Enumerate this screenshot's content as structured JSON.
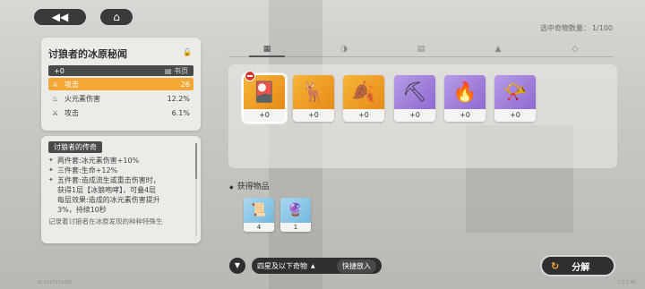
{
  "nav": {
    "back_icon": "back-arrow-icon",
    "home_icon": "home-icon"
  },
  "counter": {
    "label": "选中奇物数量：",
    "value": "1/100"
  },
  "set": {
    "title": "讨狼者的冰原秘闻",
    "level": "+0",
    "book_label": "书页",
    "stats": [
      {
        "icon": "sword-icon",
        "name": "攻击",
        "value": "26",
        "main": true
      },
      {
        "icon": "fire-icon",
        "name": "火元素伤害",
        "value": "12.2%",
        "main": false
      },
      {
        "icon": "sword-icon",
        "name": "攻击",
        "value": "6.1%",
        "main": false
      }
    ]
  },
  "legend": {
    "header": "讨狼者的传奇",
    "lines": [
      {
        "bullet": "✦",
        "text": "两件套:冰元素伤害+10%"
      },
      {
        "bullet": "✦",
        "text": "三件套:生命+12%"
      },
      {
        "bullet": "✦",
        "text": "五件套:造成流生或重击伤害时，"
      }
    ],
    "cont_lines": [
      "获得1层【冰狼咆哮】，可叠4层",
      "每层效果:造成的冰元素伤害提升",
      "3%，持续10秒"
    ],
    "lore": "记录着讨狼者在冰原发现的种种特殊生"
  },
  "tabs": [
    {
      "icon": "grid-icon",
      "glyph": "▦"
    },
    {
      "icon": "leaf-icon",
      "glyph": "◑"
    },
    {
      "icon": "book-icon",
      "glyph": "▤"
    },
    {
      "icon": "flame-icon",
      "glyph": "▲"
    },
    {
      "icon": "wings-icon",
      "glyph": "◇"
    }
  ],
  "inventory": [
    {
      "name": "item-scroll-cloth",
      "glyph": "🎴",
      "rarity": "orange",
      "level": "+0"
    },
    {
      "name": "item-antler",
      "glyph": "🦌",
      "rarity": "orange",
      "level": "+0"
    },
    {
      "name": "item-leaf",
      "glyph": "🍂",
      "rarity": "orange",
      "level": "+0"
    },
    {
      "name": "item-pickaxe",
      "glyph": "⛏",
      "rarity": "purple",
      "level": "+0"
    },
    {
      "name": "item-torch",
      "glyph": "🔥",
      "rarity": "purple",
      "level": "+0"
    },
    {
      "name": "item-horn",
      "glyph": "📯",
      "rarity": "purple",
      "level": "+0"
    }
  ],
  "obtained": {
    "title": "获得物品",
    "items": [
      {
        "name": "obtained-paper",
        "glyph": "📜",
        "count": "4"
      },
      {
        "name": "obtained-orb",
        "glyph": "🔮",
        "count": "1"
      }
    ]
  },
  "bottom": {
    "filter_icon": "filter-icon",
    "select_label": "四星及以下奇物",
    "quick_label": "快捷放入",
    "decompose_label": "分解",
    "uid": "ID:1017711003",
    "version": "1.0.1.46"
  }
}
